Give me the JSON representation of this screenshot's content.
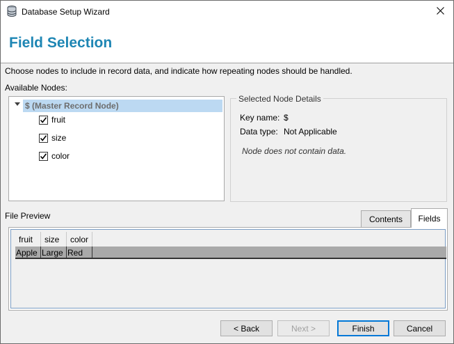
{
  "window": {
    "title": "Database Setup Wizard"
  },
  "header": {
    "page_title": "Field Selection"
  },
  "instructions": "Choose nodes to include in record data, and indicate how repeating nodes should be handled.",
  "available_nodes": {
    "label": "Available Nodes:",
    "root": "$ (Master Record Node)",
    "items": [
      {
        "label": "fruit",
        "checked": true
      },
      {
        "label": "size",
        "checked": true
      },
      {
        "label": "color",
        "checked": true
      }
    ]
  },
  "details": {
    "legend": "Selected Node Details",
    "key_name_label": "Key name:",
    "key_name_value": "$",
    "data_type_label": "Data type:",
    "data_type_value": "Not Applicable",
    "note": "Node does not contain data."
  },
  "preview": {
    "label": "File Preview",
    "tabs": [
      {
        "label": "Contents",
        "selected": false
      },
      {
        "label": "Fields",
        "selected": true
      }
    ],
    "columns": [
      "fruit",
      "size",
      "color"
    ],
    "rows": [
      [
        "Apple",
        "Large",
        "Red"
      ]
    ]
  },
  "buttons": {
    "back": "< Back",
    "next": "Next >",
    "finish": "Finish",
    "cancel": "Cancel"
  }
}
